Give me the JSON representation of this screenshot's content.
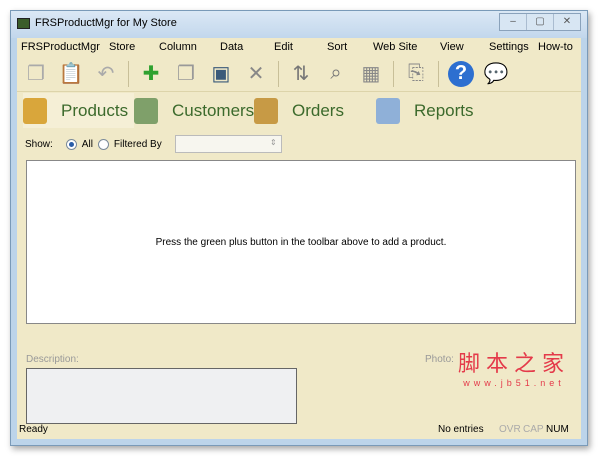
{
  "window": {
    "title": "FRSProductMgr for My Store",
    "minimize": "–",
    "maximize": "▢",
    "close": "✕"
  },
  "menu": [
    "FRSProductMgr",
    "Store",
    "Column",
    "Data",
    "Edit",
    "Sort",
    "Web Site",
    "View",
    "Settings",
    "How-to"
  ],
  "toolbar": [
    {
      "name": "copy-icon",
      "glyph": "❐",
      "color": "#aaa"
    },
    {
      "name": "paste-icon",
      "glyph": "📋",
      "color": "#aaa"
    },
    {
      "name": "undo-icon",
      "glyph": "↶",
      "color": "#aaa"
    },
    {
      "sep": true
    },
    {
      "name": "add-product-icon",
      "glyph": "✚",
      "color": "#2fa12f"
    },
    {
      "name": "duplicate-icon",
      "glyph": "❐",
      "color": "#999"
    },
    {
      "name": "add-photo-icon",
      "glyph": "▣",
      "color": "#3a5a7a"
    },
    {
      "name": "delete-icon",
      "glyph": "✕",
      "color": "#888"
    },
    {
      "sep": true
    },
    {
      "name": "sort-az-icon",
      "glyph": "⇅",
      "color": "#777"
    },
    {
      "name": "find-icon",
      "glyph": "⌕",
      "color": "#777"
    },
    {
      "name": "photo-search-icon",
      "glyph": "▦",
      "color": "#888"
    },
    {
      "sep": true
    },
    {
      "name": "export-icon",
      "glyph": "⎘",
      "color": "#888"
    },
    {
      "sep": true
    },
    {
      "name": "help-icon",
      "glyph": "?",
      "color": "#fff",
      "bg": "#2d6fd0"
    },
    {
      "name": "feedback-icon",
      "glyph": "💬",
      "color": "#aaa"
    }
  ],
  "tabs": [
    {
      "label": "Products",
      "color": "#d9a63b"
    },
    {
      "label": "Customers",
      "color": "#7fa06a"
    },
    {
      "label": "Orders",
      "color": "#c79a45"
    },
    {
      "label": "Reports",
      "color": "#8fb0d8"
    }
  ],
  "filter": {
    "show_label": "Show:",
    "all_label": "All",
    "filtered_label": "Filtered By",
    "selected": "All"
  },
  "grid": {
    "empty_message": "Press the green plus button in the toolbar above to add a product."
  },
  "description_label": "Description:",
  "photo_label": "Photo:",
  "status": {
    "ready": "Ready",
    "entries": "No entries",
    "ovr": "OVR",
    "cap": "CAP",
    "num": "NUM"
  },
  "watermark": {
    "line1": "脚本之家",
    "line2": "www.jb51.net"
  }
}
